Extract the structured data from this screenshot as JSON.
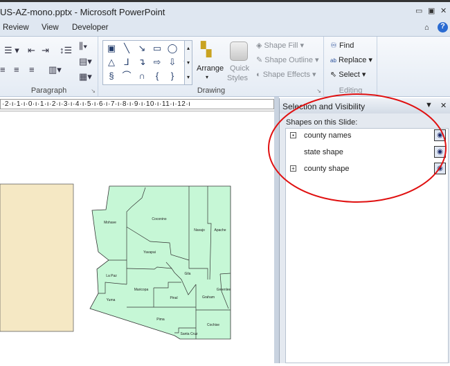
{
  "window": {
    "title": "US-AZ-mono.pptx - Microsoft PowerPoint",
    "controls": [
      "minimize",
      "restore",
      "close"
    ]
  },
  "tabs": [
    {
      "label": "Review"
    },
    {
      "label": "View"
    },
    {
      "label": "Developer"
    }
  ],
  "ribbon": {
    "paragraph": {
      "label": "Paragraph"
    },
    "drawing": {
      "label": "Drawing",
      "arrange": "Arrange",
      "quick_styles_1": "Quick",
      "quick_styles_2": "Styles",
      "shape_fill": "Shape Fill",
      "shape_outline": "Shape Outline",
      "shape_effects": "Shape Effects"
    },
    "editing": {
      "label": "Editing",
      "find": "Find",
      "replace": "Replace",
      "select": "Select"
    }
  },
  "ruler": {
    "text": "·2·ı·1·ı·0·ı·1·ı·2·ı·3·ı·4·ı·5·ı·6·ı·7·ı·8·ı·9·ı·10·ı·11·ı·12·ı"
  },
  "pane": {
    "title": "Selection and Visibility",
    "subtitle": "Shapes on this Slide:",
    "items": [
      {
        "label": "county names",
        "expander": "plus-filled"
      },
      {
        "label": "state shape",
        "expander": ""
      },
      {
        "label": "county shape",
        "expander": "plus"
      }
    ]
  },
  "map": {
    "counties": [
      "Mohave",
      "Coconino",
      "Navajo",
      "Apache",
      "Yavapai",
      "La Paz",
      "Gila",
      "Greenlee",
      "Maricopa",
      "Pinal",
      "Graham",
      "Yuma",
      "Pima",
      "Cochise",
      "Santa Cruz"
    ],
    "fill": "#c6f7d6",
    "neighbor_fill": "#f5e8c4"
  },
  "annotation": {
    "color": "#e01010"
  }
}
